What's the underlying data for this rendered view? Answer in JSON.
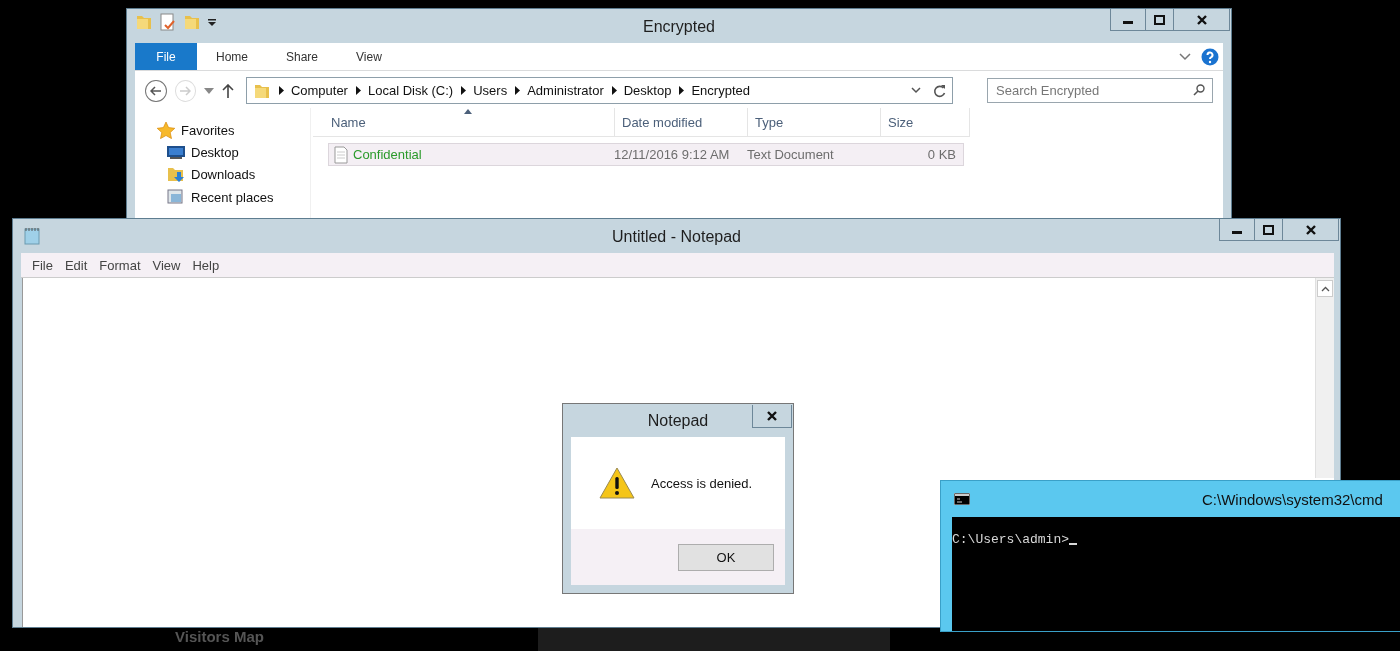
{
  "explorer": {
    "title": "Encrypted",
    "ribbon_tabs": [
      {
        "label": "File",
        "kind": "file"
      },
      {
        "label": "Home",
        "kind": "tab"
      },
      {
        "label": "Share",
        "kind": "tab"
      },
      {
        "label": "View",
        "kind": "tab"
      }
    ],
    "breadcrumb": [
      "Computer",
      "Local Disk (C:)",
      "Users",
      "Administrator",
      "Desktop",
      "Encrypted"
    ],
    "search": {
      "placeholder": "Search Encrypted"
    },
    "nav": {
      "heading": "Favorites",
      "items": [
        {
          "label": "Desktop",
          "kind": "desktop"
        },
        {
          "label": "Downloads",
          "kind": "downloads"
        },
        {
          "label": "Recent places",
          "kind": "recent"
        }
      ]
    },
    "columns": [
      {
        "label": "Name",
        "sorted": true
      },
      {
        "label": "Date modified",
        "sorted": false
      },
      {
        "label": "Type",
        "sorted": false
      },
      {
        "label": "Size",
        "sorted": false
      }
    ],
    "rows": [
      {
        "name": "Confidential",
        "date": "12/11/2016 9:12 AM",
        "type": "Text Document",
        "size": "0 KB",
        "selected": true
      }
    ]
  },
  "notepad": {
    "title": "Untitled - Notepad",
    "menu": [
      "File",
      "Edit",
      "Format",
      "View",
      "Help"
    ]
  },
  "dialog": {
    "title": "Notepad",
    "message": "Access is denied.",
    "button": "OK"
  },
  "cmd": {
    "title": "C:\\Windows\\system32\\cmd",
    "prompt": "C:\\Users\\admin>"
  },
  "background": {
    "label": "Visitors Map"
  }
}
